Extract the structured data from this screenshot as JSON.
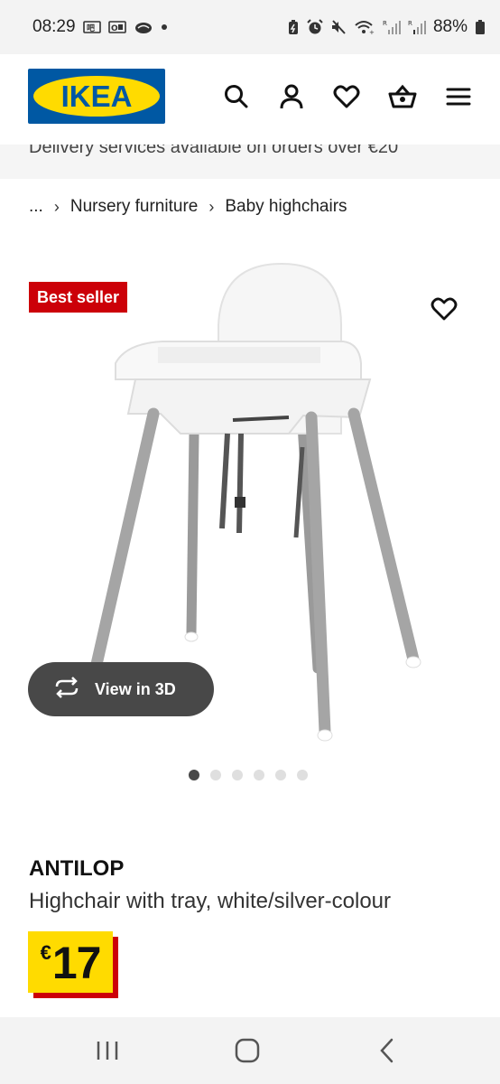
{
  "status_bar": {
    "time": "08:29",
    "battery": "88%",
    "icons": [
      "teams-icon",
      "outlook-icon",
      "cloud-icon",
      "notification-dot",
      "battery-saver-icon",
      "alarm-icon",
      "mute-icon",
      "wifi-icon",
      "signal-icon-1",
      "signal-icon-2",
      "battery-icon"
    ]
  },
  "header": {
    "logo_text": "IKEA",
    "logo_colors": {
      "blue": "#0058a3",
      "yellow": "#ffdb00"
    },
    "icons": [
      "search-icon",
      "account-icon",
      "heart-icon",
      "basket-icon",
      "menu-icon"
    ]
  },
  "promo": {
    "text": "Delivery services available on orders over €20"
  },
  "breadcrumb": {
    "ellipsis": "...",
    "separator": "›",
    "items": [
      "Nursery furniture",
      "Baby highchairs"
    ]
  },
  "product": {
    "badge": "Best seller",
    "badge_color": "#cc0008",
    "view3d_label": "View in 3D",
    "gallery": {
      "total": 6,
      "active_index": 0
    },
    "name": "ANTILOP",
    "description": "Highchair with tray, white/silver-colour",
    "price_currency": "€",
    "price_amount": "17"
  },
  "nav_bar": {
    "icons": [
      "recent-apps-icon",
      "home-icon",
      "back-icon"
    ]
  }
}
